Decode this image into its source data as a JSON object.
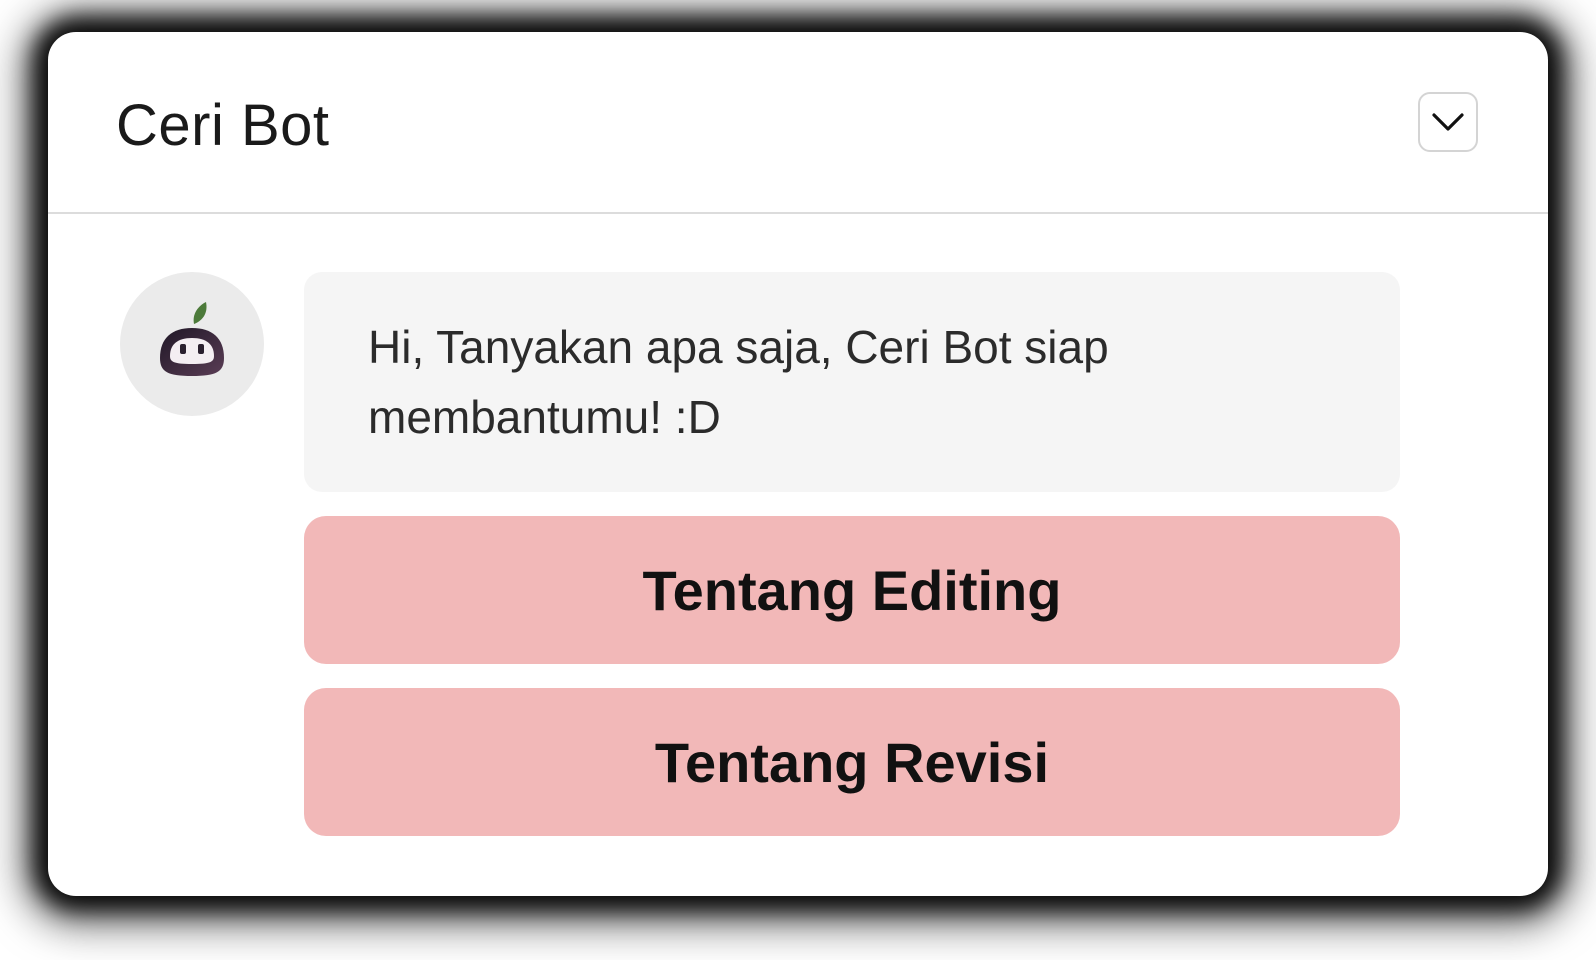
{
  "chat": {
    "title": "Ceri Bot",
    "greeting": "Hi, Tanyakan apa saja, Ceri Bot siap membantumu! :D",
    "options": [
      {
        "label": "Tentang Editing"
      },
      {
        "label": "Tentang Revisi"
      }
    ]
  },
  "icons": {
    "collapse": "chevron-down-icon",
    "avatar": "bot-avatar-icon"
  },
  "colors": {
    "option_bg": "#f2b8b8",
    "bubble_bg": "#f5f5f5",
    "avatar_bg": "#ebebeb",
    "leaf": "#4c7a3a",
    "bot_body": "#2e2235"
  }
}
